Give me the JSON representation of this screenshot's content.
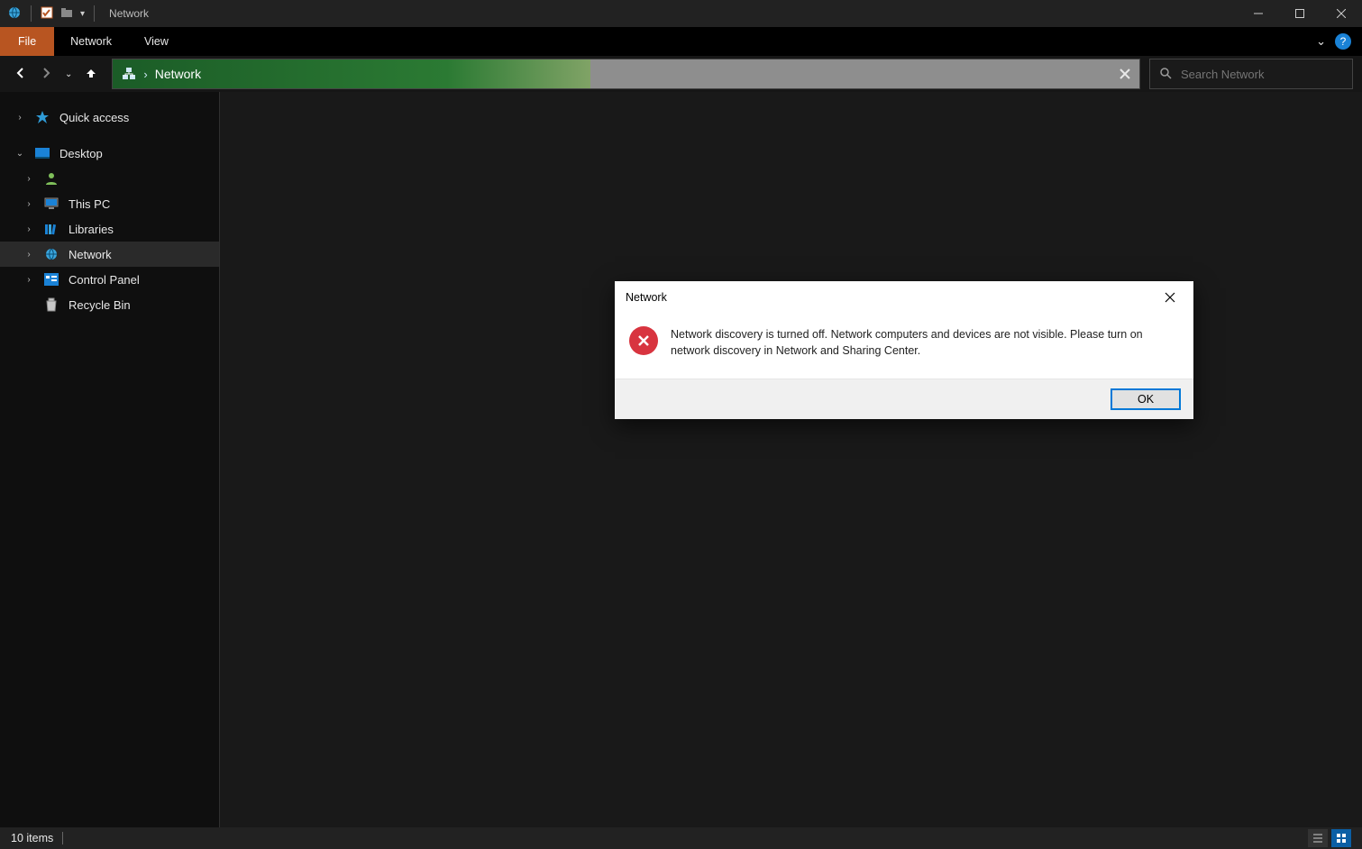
{
  "window": {
    "title": "Network"
  },
  "ribbon": {
    "file": "File",
    "tabs": [
      "Network",
      "View"
    ],
    "help_tooltip": "?"
  },
  "address": {
    "breadcrumb": "Network",
    "search_placeholder": "Search Network"
  },
  "sidebar": {
    "quick_access": "Quick access",
    "desktop": "Desktop",
    "this_pc": "This PC",
    "libraries": "Libraries",
    "network": "Network",
    "control_panel": "Control Panel",
    "recycle_bin": "Recycle Bin"
  },
  "dialog": {
    "title": "Network",
    "message": "Network discovery is turned off. Network computers and devices are not visible. Please turn on network discovery in Network and Sharing Center.",
    "ok": "OK"
  },
  "status": {
    "items": "10 items"
  }
}
